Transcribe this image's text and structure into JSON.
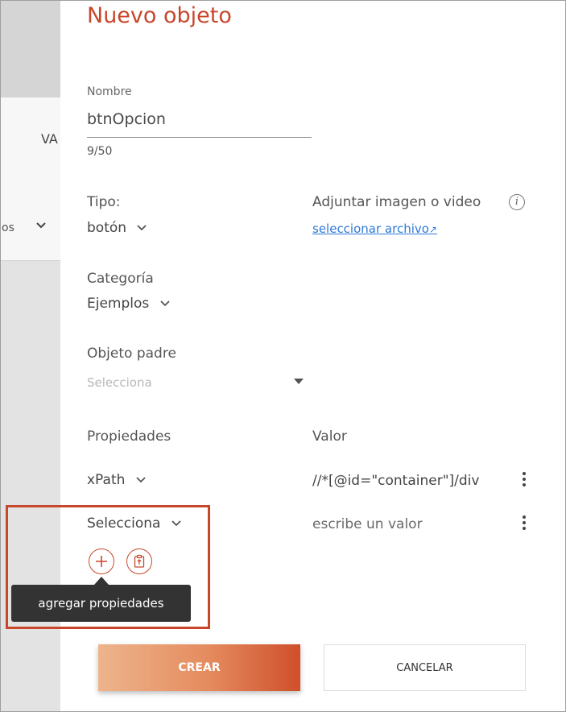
{
  "background": {
    "column_header_fragment": "VA",
    "filter_fragment": "os"
  },
  "modal": {
    "title": "Nuevo objeto",
    "name": {
      "label": "Nombre",
      "value": "btnOpcion",
      "counter": "9/50"
    },
    "type": {
      "label": "Tipo:",
      "value": "botón"
    },
    "attachment": {
      "label": "Adjuntar imagen o video",
      "link": "seleccionar archivo",
      "link_icon": "↗"
    },
    "category": {
      "label": "Categoría",
      "value": "Ejemplos"
    },
    "parent": {
      "label": "Objeto padre",
      "placeholder": "Selecciona"
    },
    "properties": {
      "header_property": "Propiedades",
      "header_value": "Valor",
      "rows": [
        {
          "property": "xPath",
          "value": "//*[@id=\"container\"]/div"
        },
        {
          "property": "Selecciona",
          "value": "escribe un valor"
        }
      ]
    },
    "tooltip": "agregar propiedades",
    "buttons": {
      "create": "CREAR",
      "cancel": "CANCELAR"
    }
  },
  "colors": {
    "accent": "#c8472b",
    "link": "#2f7ad6"
  }
}
